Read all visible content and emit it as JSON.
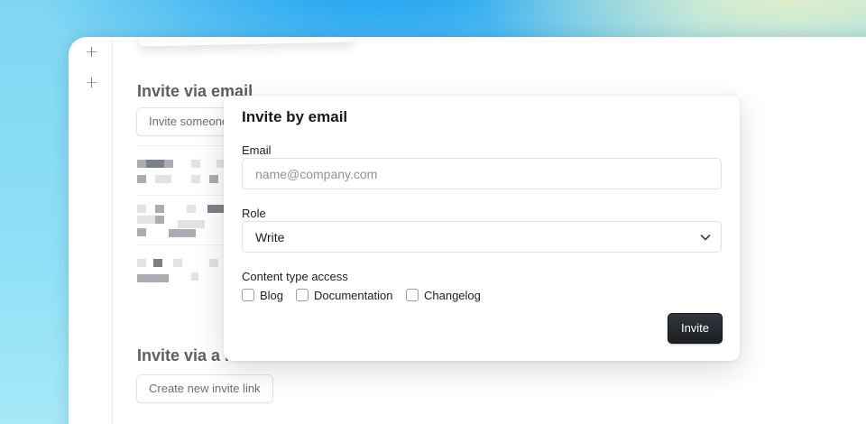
{
  "rail": {
    "icons": [
      "plus-icon",
      "plus-icon"
    ]
  },
  "background_page": {
    "invite_email_heading": "Invite via email",
    "invite_someone_button": "Invite someone",
    "invite_link_heading": "Invite via a link",
    "create_link_button": "Create new invite link"
  },
  "dialog": {
    "title": "Invite by email",
    "email_label": "Email",
    "email_placeholder": "name@company.com",
    "email_value": "",
    "role_label": "Role",
    "role_value": "Write",
    "content_access_label": "Content type access",
    "content_types": [
      {
        "label": "Blog",
        "checked": false
      },
      {
        "label": "Documentation",
        "checked": false
      },
      {
        "label": "Changelog",
        "checked": false
      }
    ],
    "invite_button": "Invite"
  },
  "colors": {
    "primary_button": "#1d1f24",
    "text": "#1c1d21",
    "muted_text": "#6b6e75",
    "border": "#e1e2e6"
  }
}
